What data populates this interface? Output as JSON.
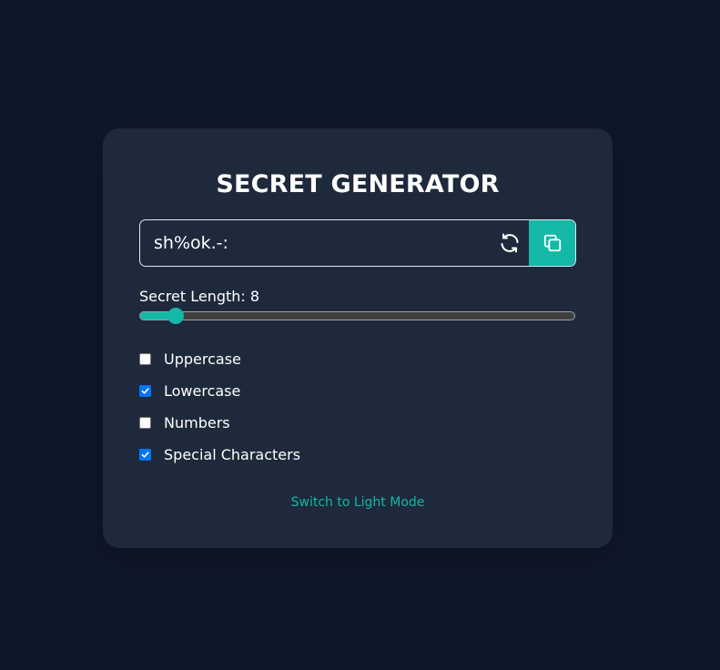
{
  "title": "SECRET GENERATOR",
  "secret": {
    "value": "sh%ok.-:",
    "refresh_icon": "refresh-icon",
    "copy_icon": "copy-icon"
  },
  "length": {
    "label": "Secret Length: 8",
    "value": 8,
    "min": 4,
    "max": 64
  },
  "options": [
    {
      "label": "Uppercase",
      "checked": false
    },
    {
      "label": "Lowercase",
      "checked": true
    },
    {
      "label": "Numbers",
      "checked": false
    },
    {
      "label": "Special Characters",
      "checked": true
    }
  ],
  "mode_toggle": "Switch to Light Mode",
  "colors": {
    "background": "#0f172a",
    "card": "#1e293b",
    "accent": "#14b8a6",
    "checkbox_checked": "#0075ff"
  }
}
